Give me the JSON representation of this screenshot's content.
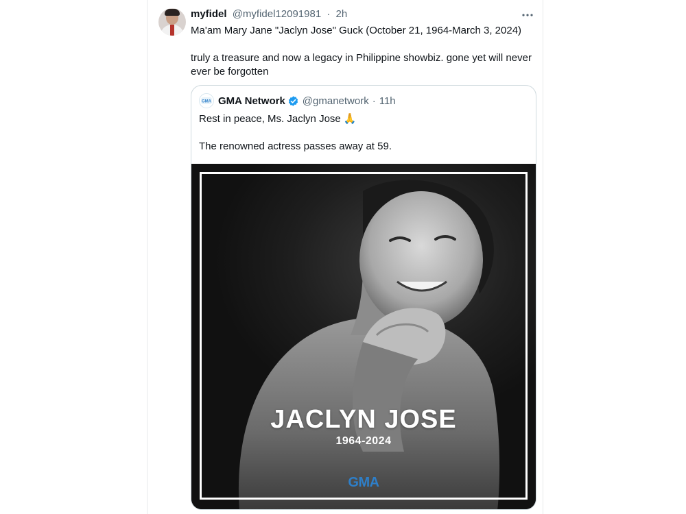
{
  "tweet": {
    "display_name": "myfidel",
    "handle": "@myfidel12091981",
    "separator": "·",
    "time": "2h",
    "more_icon": "more-horizontal-icon",
    "lines": [
      "Ma'am Mary Jane \"Jaclyn Jose\" Guck (October 21, 1964-March 3, 2024)",
      "truly a treasure and now a legacy in Philippine showbiz. gone yet will never ever be forgotten"
    ]
  },
  "quote": {
    "display_name": "GMA Network",
    "handle": "@gmanetwork",
    "separator": "·",
    "time": "11h",
    "verified_color": "#1d9bf0",
    "lines": [
      "Rest in peace, Ms. Jaclyn Jose 🙏",
      "The renowned actress passes away at 59."
    ],
    "media": {
      "name": "JACLYN JOSE",
      "years": "1964-2024",
      "logo_text": "GMA"
    }
  }
}
